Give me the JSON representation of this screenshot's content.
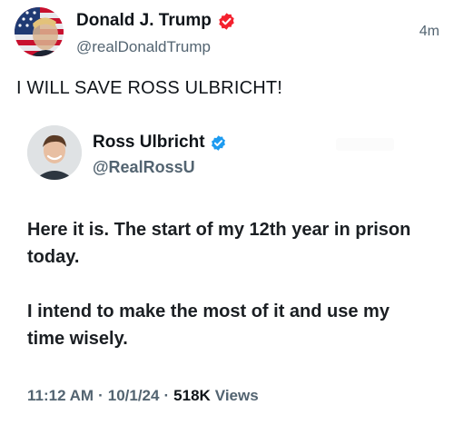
{
  "post": {
    "author_name": "Donald J. Trump",
    "handle": "@realDonaldTrump",
    "time_ago": "4m",
    "text": "I WILL SAVE ROSS ULBRICHT!"
  },
  "quoted_tweet": {
    "author_name": "Ross Ulbricht",
    "handle": "@RealRossU",
    "paragraphs": [
      "Here it is. The start of my 12th year in prison today.",
      "I intend to make the most of it and use my time wisely."
    ],
    "time": "11:12 AM",
    "separator": "·",
    "date": "10/1/24",
    "views_count": "518K",
    "views_label": "Views"
  },
  "colors": {
    "verified_red": "#f4212e",
    "verified_blue": "#1d9bf0",
    "secondary_text": "#536471"
  }
}
